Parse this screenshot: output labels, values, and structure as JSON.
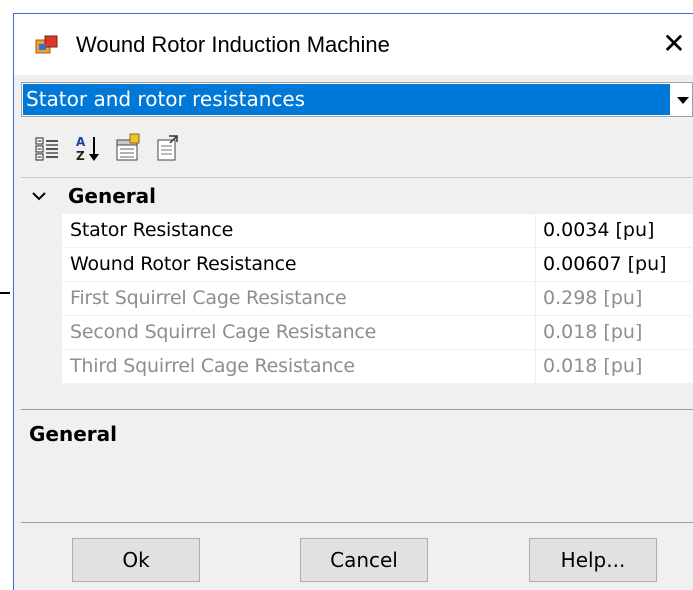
{
  "window": {
    "title": "Wound Rotor Induction Machine",
    "close_glyph": "✕",
    "icon": "app-block-icon"
  },
  "category_select": {
    "selected": "Stator and rotor resistances"
  },
  "toolbar": {
    "buttons": [
      {
        "icon": "categorized-view-icon"
      },
      {
        "icon": "alphabetical-sort-icon"
      },
      {
        "icon": "property-pages-icon"
      },
      {
        "icon": "export-icon"
      }
    ]
  },
  "property_grid": {
    "category": "General",
    "rows": [
      {
        "name": "Stator Resistance",
        "value": "0.0034 [pu]",
        "enabled": true
      },
      {
        "name": "Wound Rotor Resistance",
        "value": "0.00607 [pu]",
        "enabled": true
      },
      {
        "name": "First Squirrel Cage Resistance",
        "value": "0.298 [pu]",
        "enabled": false
      },
      {
        "name": "Second Squirrel Cage Resistance",
        "value": "0.018 [pu]",
        "enabled": false
      },
      {
        "name": "Third Squirrel Cage Resistance",
        "value": "0.018 [pu]",
        "enabled": false
      }
    ]
  },
  "description": {
    "title": "General"
  },
  "buttons": {
    "ok": "Ok",
    "cancel": "Cancel",
    "help": "Help..."
  },
  "colors": {
    "selection": "#0078d7",
    "disabled_text": "#8e8e8e",
    "window_border": "#2b79d6"
  }
}
